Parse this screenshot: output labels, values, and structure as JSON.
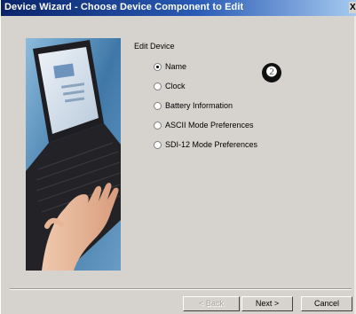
{
  "window": {
    "title": "Device Wizard - Choose Device Component to Edit",
    "close_label": "X"
  },
  "form": {
    "group_label": "Edit Device",
    "options": [
      {
        "label": "Name",
        "selected": true
      },
      {
        "label": "Clock",
        "selected": false
      },
      {
        "label": "Battery Information",
        "selected": false
      },
      {
        "label": "ASCII Mode Preferences",
        "selected": false
      },
      {
        "label": "SDI-12 Mode Preferences",
        "selected": false
      }
    ]
  },
  "annotation": {
    "badge": "❷"
  },
  "buttons": {
    "back": "< Back",
    "next": "Next >",
    "cancel": "Cancel"
  },
  "colors": {
    "titlebar_start": "#0a246a",
    "titlebar_end": "#a6caf0",
    "dialog_bg": "#d6d3ce",
    "hero_blue": "#3f78a8"
  },
  "icons": {
    "hero": "laptop-typing-hand-illustration",
    "badge": "step-number-2-icon"
  }
}
